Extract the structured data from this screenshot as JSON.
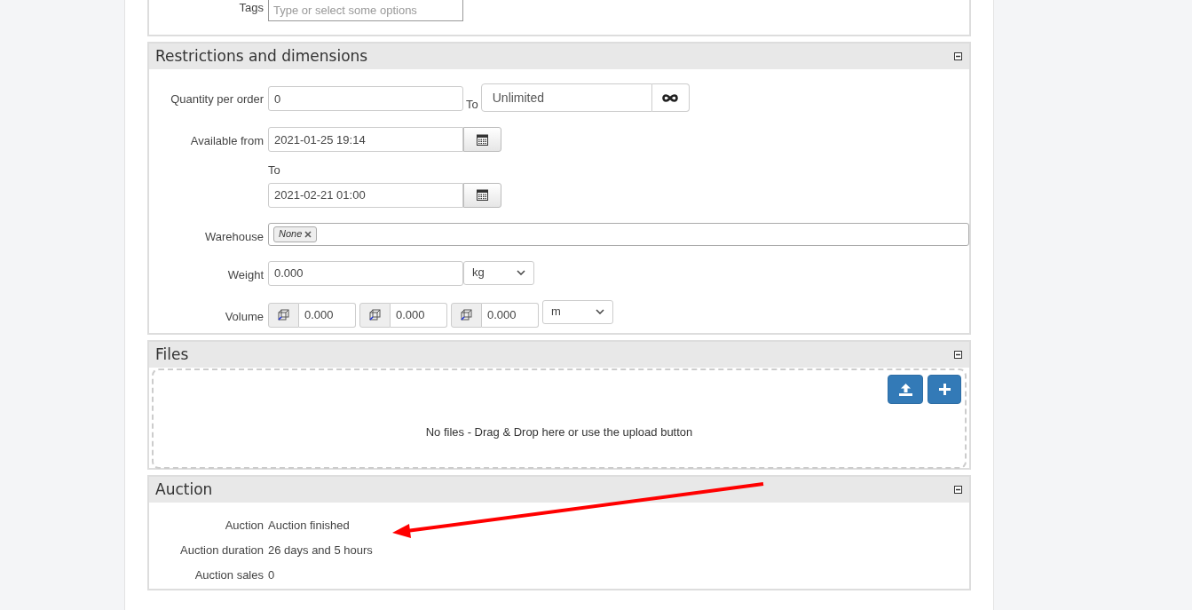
{
  "tags": {
    "label": "Tags",
    "placeholder": "Type or select some options"
  },
  "restrictions": {
    "title": "Restrictions and dimensions",
    "quantity": {
      "label": "Quantity per order",
      "from": "0",
      "to_label": "To",
      "to_value": "Unlimited"
    },
    "available": {
      "label": "Available from",
      "from": "2021-01-25 19:14",
      "to_label": "To",
      "to": "2021-02-21 01:00"
    },
    "warehouse": {
      "label": "Warehouse",
      "tags": [
        "None"
      ]
    },
    "weight": {
      "label": "Weight",
      "value": "0.000",
      "unit": "kg"
    },
    "volume": {
      "label": "Volume",
      "values": [
        "0.000",
        "0.000",
        "0.000"
      ],
      "unit": "m"
    }
  },
  "files": {
    "title": "Files",
    "empty_text": "No files - Drag & Drop here or use the upload button"
  },
  "auction": {
    "title": "Auction",
    "rows": [
      {
        "label": "Auction",
        "value": "Auction finished"
      },
      {
        "label": "Auction duration",
        "value": "26 days and 5 hours"
      },
      {
        "label": "Auction sales",
        "value": "0"
      }
    ]
  }
}
